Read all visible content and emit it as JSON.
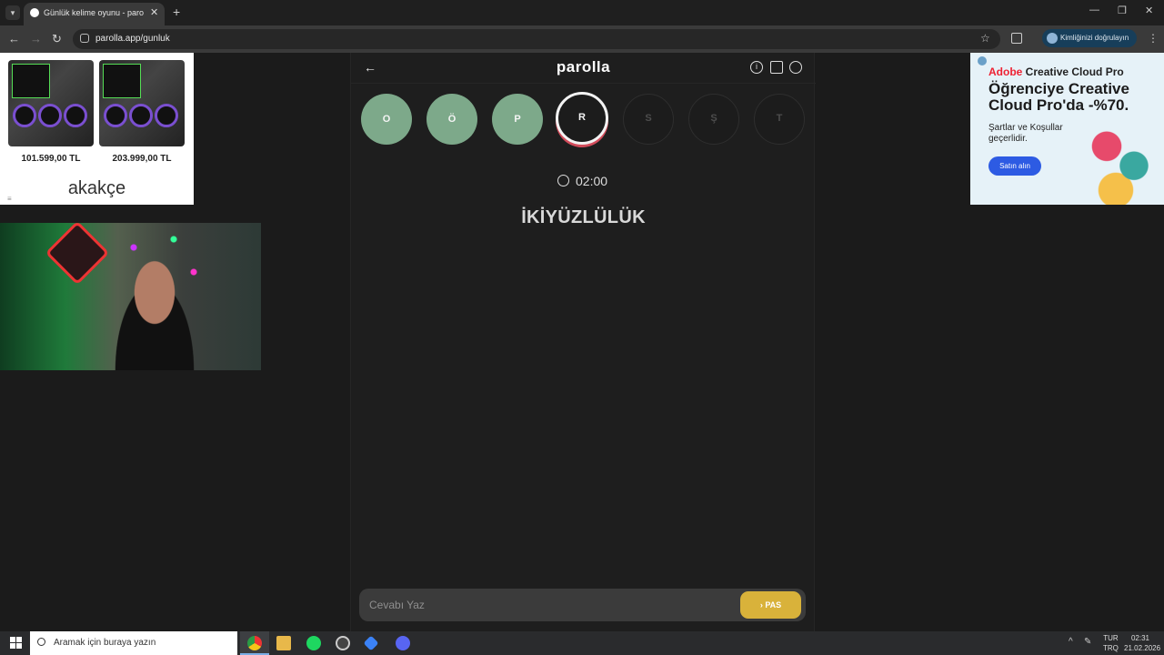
{
  "browser": {
    "tab_title": "Günlük kelime oyunu - parolla",
    "tab_close": "✕",
    "new_tab": "+",
    "url": "parolla.app/gunluk",
    "profile_label": "Kimliğinizi doğrulayın",
    "window_controls": [
      "—",
      "❐",
      "✕"
    ]
  },
  "ads": {
    "left": {
      "prices": [
        "101.599,00 TL",
        "203.999,00 TL"
      ],
      "brand": "akakçe",
      "mark": "≡"
    },
    "right": {
      "brand_red": "Adobe",
      "brand_rest": " Creative Cloud Pro",
      "headline": "Öğrenciye Creative Cloud Pro'da -%70.",
      "terms": "Şartlar ve Koşullar geçerlidir.",
      "cta": "Satın alın"
    }
  },
  "game": {
    "logo": "parolla",
    "letters": [
      {
        "char": "O",
        "state": "done"
      },
      {
        "char": "Ö",
        "state": "done"
      },
      {
        "char": "P",
        "state": "done"
      },
      {
        "char": "R",
        "state": "current"
      },
      {
        "char": "S",
        "state": "pending"
      },
      {
        "char": "Ş",
        "state": "pending"
      },
      {
        "char": "T",
        "state": "pending"
      }
    ],
    "timer": "02:00",
    "word": "İKİYÜZLÜLÜK",
    "answer_placeholder": "Cevabı Yaz",
    "pass_label": "PAS",
    "colors": {
      "done": "#7da98a",
      "current_ring": "#d24c5b",
      "pass": "#d9b23a"
    }
  },
  "taskbar": {
    "search_placeholder": "Aramak için buraya yazın",
    "lang_top": "TUR",
    "lang_bottom": "TRQ",
    "time": "02:31",
    "date": "21.02.2026"
  }
}
